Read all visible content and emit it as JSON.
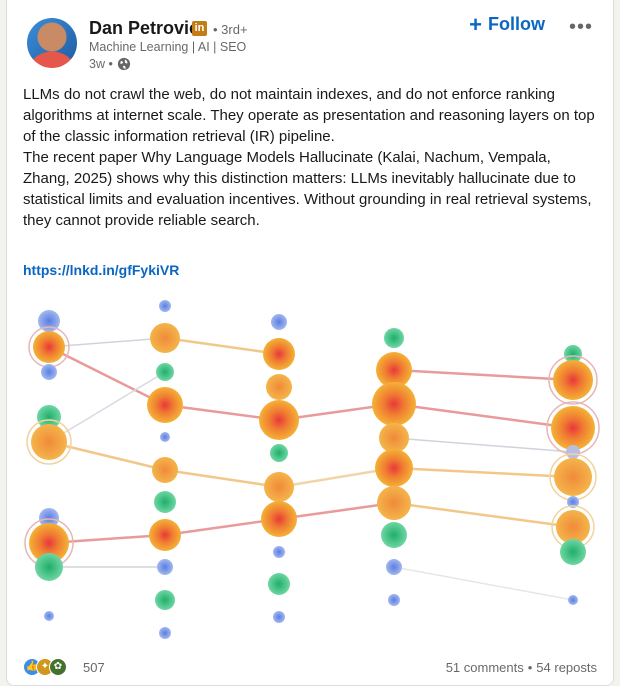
{
  "author": {
    "name": "Dan Petrovic",
    "badge": "in",
    "degree": "• 3rd+",
    "headline": "Machine Learning | AI | SEO",
    "time": "3w •"
  },
  "actions": {
    "follow_label": "Follow",
    "follow_icon": "plus-icon",
    "more_icon": "ellipsis-icon"
  },
  "post": {
    "paragraph1": "LLMs do not crawl the web, do not maintain indexes, and do not enforce ranking algorithms at internet scale. They operate as presentation and reasoning layers on top of the classic information retrieval (IR) pipeline.",
    "paragraph2": "The recent paper Why Language Models Hallucinate (Kalai, Nachum, Vempala, Zhang, 2025) shows why this distinction matters: LLMs inevitably hallucinate due to statistical limits and evaluation incentives. Without grounding in real retrieval systems, they cannot provide reliable search.",
    "link": "https://lnkd.in/gfFykiVR"
  },
  "social": {
    "reaction_count": "507",
    "comments": "51 comments",
    "separator": "•",
    "reposts": "54 reposts",
    "reaction_icons": [
      "like-icon",
      "celebrate-icon",
      "insightful-icon"
    ]
  },
  "colors": {
    "accent": "#0a66c2",
    "blue_node": "#7b97e6",
    "green_node": "#2fbf7f",
    "orange_node": "#f2a830",
    "red_core": "#e8383b"
  }
}
